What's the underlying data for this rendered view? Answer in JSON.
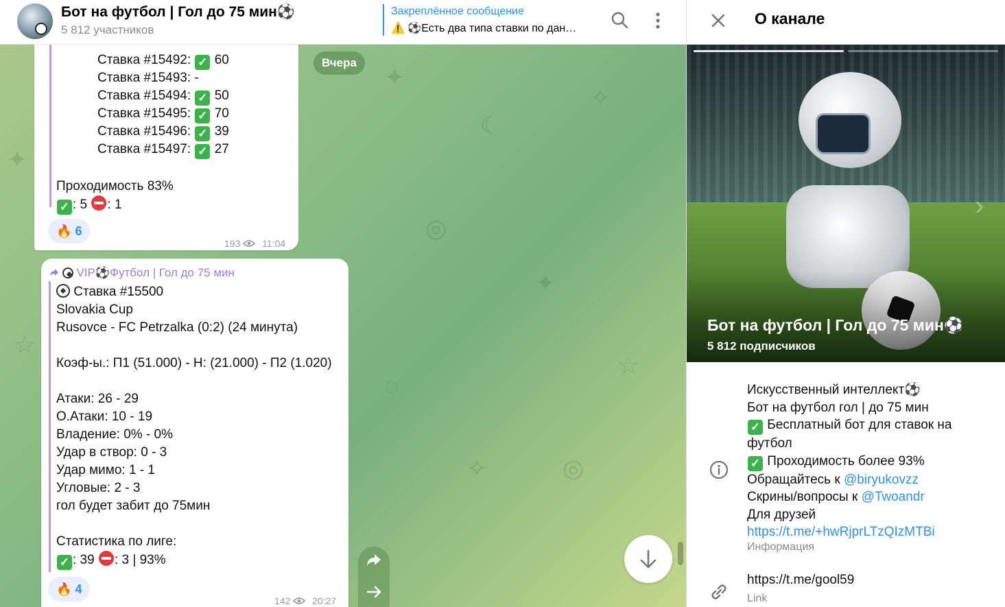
{
  "chat": {
    "title": "Бот на футбол | Гол до 75 мин⚽",
    "subtitle": "5 812 участников",
    "pinned": {
      "title": "Закреплённое сообщение",
      "text": "⚠️ ⚽Есть два типа ставки по дан…"
    },
    "date_badge": "Вчера",
    "message1": {
      "bets": [
        {
          "label": "Ставка #15492:",
          "result": "check",
          "value": "60"
        },
        {
          "label": "Ставка #15493:",
          "result": "none",
          "value": "-"
        },
        {
          "label": "Ставка #15494:",
          "result": "check",
          "value": "50"
        },
        {
          "label": "Ставка #15495:",
          "result": "check",
          "value": "70"
        },
        {
          "label": "Ставка #15496:",
          "result": "check",
          "value": "39"
        },
        {
          "label": "Ставка #15497:",
          "result": "check",
          "value": "27"
        }
      ],
      "pass_rate": "Проходимость 83%",
      "wins": ": 5",
      "losses": ": 1",
      "reaction_count": "6",
      "views": "193",
      "time": "11:04"
    },
    "message2": {
      "forwarded_from": "VIP⚽Футбол | Гол до 75 мин",
      "bet_title": "Ставка #15500",
      "league": "Slovakia Cup",
      "match": "Rusovce - FC Petrzalka (0:2) (24 минута)",
      "odds": "Коэф-ы.: П1 (51.000) - Н: (21.000) - П2 (1.020)",
      "attacks": "Атаки: 26 - 29",
      "danger_attacks": "О.Атаки: 10 - 19",
      "possession": "Владение: 0% - 0%",
      "shots_on": "Удар в створ: 0 - 3",
      "shots_off": "Удар мимо: 1 - 1",
      "corners": "Угловые: 2 - 3",
      "prediction": "гол будет забит до 75мин",
      "league_stats_title": "Статистика по лиге:",
      "league_stats_wins": ": 39",
      "league_stats_losses": ": 3 | 93%",
      "reaction_count": "4",
      "views": "142",
      "time": "20:27"
    }
  },
  "panel": {
    "title": "О канале",
    "cover_name": "Бот на футбол | Гол до 75 мин⚽",
    "cover_count": "5 812 подписчиков",
    "description": {
      "line1": "Искусственный интеллект⚽",
      "line2": "Бот на футбол гол | до 75 мин",
      "line3": "Бесплатный бот для ставок на футбол",
      "line4": "Проходимость более 93%",
      "line5_prefix": "Обращайтесь к ",
      "line5_link": "@biryukovzz",
      "line6_prefix": "Скрины/вопросы к ",
      "line6_link": "@Twoandr",
      "line7": "Для друзей",
      "line8_link": "https://t.me/+hwRjprLTzQIzMTBi"
    },
    "description_label": "Информация",
    "link_value": "https://t.me/gool59",
    "link_label": "Link"
  },
  "colors": {
    "accent": "#3390ec",
    "quote": "#b49ce6",
    "forward_name": "#9a7fd6",
    "check": "#3bb34a",
    "stop": "#e0393e"
  },
  "icons": [
    "search-icon",
    "more-vertical-icon",
    "forward-icon",
    "share-icon",
    "arrow-down-icon",
    "close-icon",
    "info-icon",
    "link-icon",
    "fire-icon",
    "eye-icon",
    "check-icon",
    "stop-icon",
    "soccer-ball-icon"
  ]
}
